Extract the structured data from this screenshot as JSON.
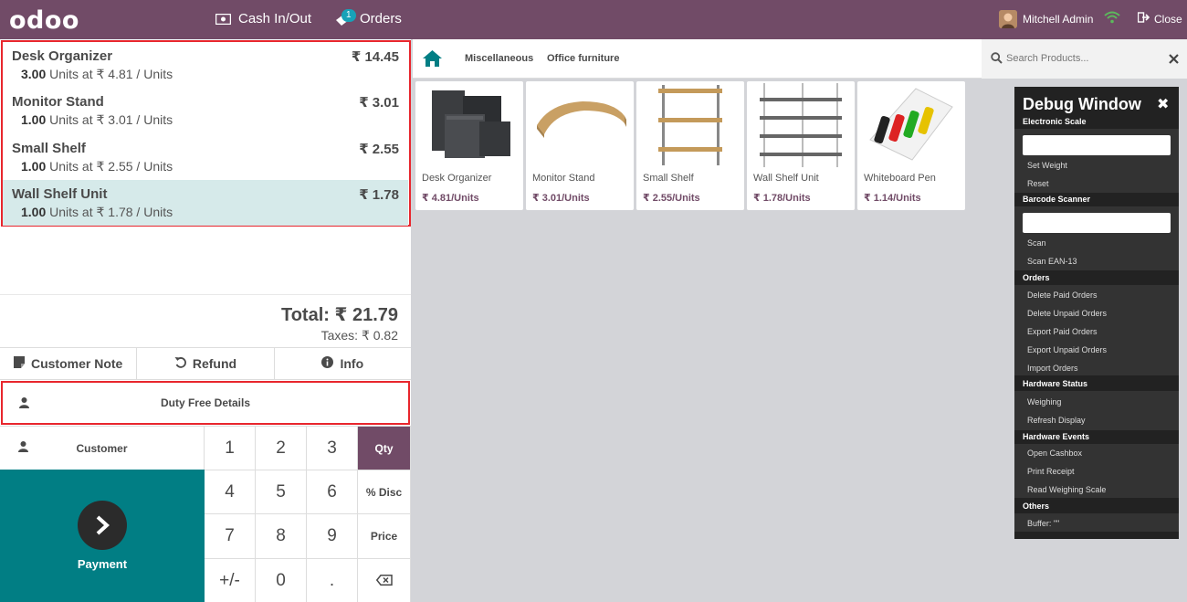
{
  "header": {
    "logo": "odoo",
    "cash_label": "Cash In/Out",
    "orders_label": "Orders",
    "orders_badge": "1",
    "user_name": "Mitchell Admin",
    "close_label": "Close"
  },
  "order": {
    "lines": [
      {
        "name": "Desk Organizer",
        "price": "₹ 14.45",
        "qty": "3.00",
        "unit_text": " Units at ₹ 4.81 / Units"
      },
      {
        "name": "Monitor Stand",
        "price": "₹ 3.01",
        "qty": "1.00",
        "unit_text": " Units at ₹ 3.01 / Units"
      },
      {
        "name": "Small Shelf",
        "price": "₹ 2.55",
        "qty": "1.00",
        "unit_text": " Units at ₹ 2.55 / Units"
      },
      {
        "name": "Wall Shelf Unit",
        "price": "₹ 1.78",
        "qty": "1.00",
        "unit_text": " Units at ₹ 1.78 / Units"
      }
    ],
    "total": "Total: ₹ 21.79",
    "taxes": "Taxes: ₹ 0.82"
  },
  "controls": {
    "customer_note": "Customer Note",
    "refund": "Refund",
    "info": "Info",
    "duty_free": "Duty Free Details",
    "customer": "Customer",
    "payment": "Payment"
  },
  "numpad": {
    "keys": [
      "1",
      "2",
      "3",
      "Qty",
      "4",
      "5",
      "6",
      "% Disc",
      "7",
      "8",
      "9",
      "Price",
      "+/-",
      "0",
      ".",
      ""
    ]
  },
  "categories": {
    "items": [
      "Miscellaneous",
      "Office furniture"
    ]
  },
  "search": {
    "placeholder": "Search Products..."
  },
  "products": [
    {
      "name": "Desk Organizer",
      "price": "₹ 4.81/Units"
    },
    {
      "name": "Monitor Stand",
      "price": "₹ 3.01/Units"
    },
    {
      "name": "Small Shelf",
      "price": "₹ 2.55/Units"
    },
    {
      "name": "Wall Shelf Unit",
      "price": "₹ 1.78/Units"
    },
    {
      "name": "Whiteboard Pen",
      "price": "₹ 1.14/Units"
    }
  ],
  "debug": {
    "title": "Debug Window",
    "electronic_scale": "Electronic Scale",
    "set_weight": "Set Weight",
    "reset": "Reset",
    "barcode_scanner": "Barcode Scanner",
    "scan": "Scan",
    "scan_ean": "Scan EAN-13",
    "orders": "Orders",
    "delete_paid": "Delete Paid Orders",
    "delete_unpaid": "Delete Unpaid Orders",
    "export_paid": "Export Paid Orders",
    "export_unpaid": "Export Unpaid Orders",
    "import_orders": "Import Orders",
    "hardware_status": "Hardware Status",
    "weighing": "Weighing",
    "refresh_display": "Refresh Display",
    "hardware_events": "Hardware Events",
    "open_cashbox": "Open Cashbox",
    "print_receipt": "Print Receipt",
    "read_scale": "Read Weighing Scale",
    "others": "Others",
    "buffer": "Buffer: \"\""
  },
  "colors": {
    "brand": "#714b67",
    "teal": "#017e84",
    "highlight": "#e8262d",
    "selected_line": "#d6eaea"
  }
}
